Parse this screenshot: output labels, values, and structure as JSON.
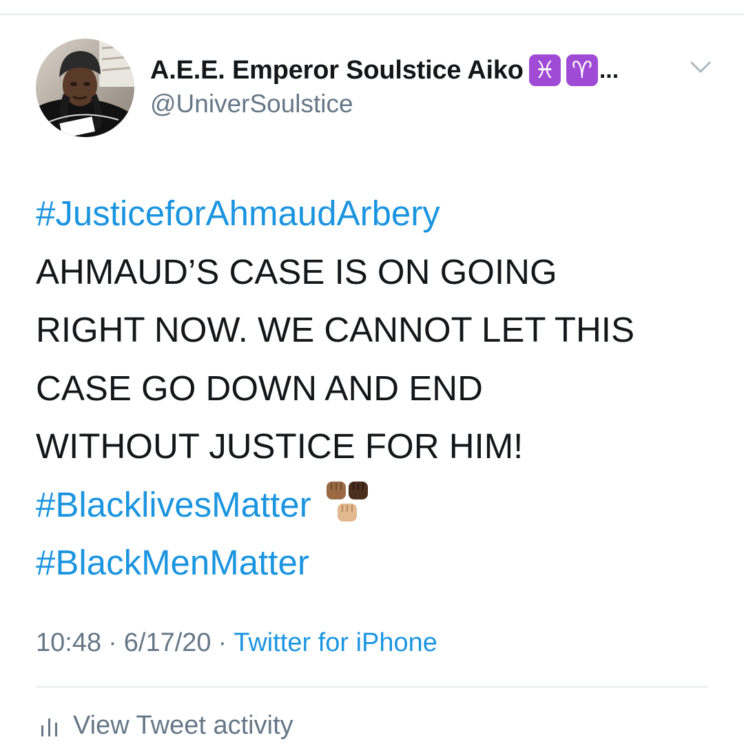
{
  "author": {
    "display_name": "A.E.E. Emperor Soulstice Aiko",
    "zodiac_1": "♓",
    "zodiac_2": "♈",
    "truncation": "...",
    "handle": "@UniverSoulstice",
    "avatar_icon": "profile-photo"
  },
  "tweet": {
    "hashtag_1": "#JusticeforAhmaudArbery",
    "body_lines": [
      "AHMAUD’S CASE IS ON GOING",
      "RIGHT NOW. WE CANNOT LET THIS",
      "CASE GO DOWN AND END",
      "WITHOUT JUSTICE FOR HIM!"
    ],
    "hashtag_2": "#BlacklivesMatter",
    "hashtag_3": "#BlackMenMatter",
    "emoji": "raised-fists-emoji"
  },
  "meta": {
    "time": "10:48",
    "separator": "·",
    "date": "6/17/20",
    "source": "Twitter for iPhone"
  },
  "activity": {
    "label": "View Tweet activity",
    "icon": "bar-chart-icon"
  },
  "colors": {
    "link": "#1b95e0",
    "secondary_text": "#657786",
    "zodiac_bg": "#a04bd6"
  }
}
